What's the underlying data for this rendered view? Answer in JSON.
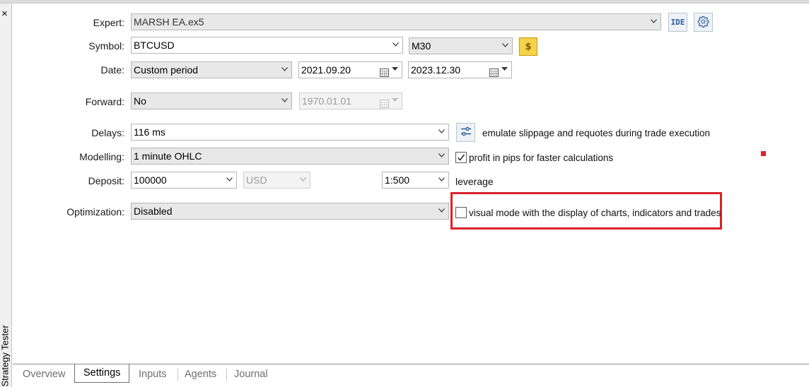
{
  "window": {
    "close_glyph": "×",
    "vertical_title": "Strategy Tester"
  },
  "expert": {
    "label": "Expert:",
    "value": "MARSH EA.ex5",
    "ide_label": "IDE",
    "settings_icon": "gear-icon"
  },
  "symbol": {
    "label": "Symbol:",
    "value": "BTCUSD",
    "timeframe": "M30",
    "symbol_icon": "dollar-icon"
  },
  "date": {
    "label": "Date:",
    "period": "Custom period",
    "from": "2021.09.20",
    "to": "2023.12.30"
  },
  "forward": {
    "label": "Forward:",
    "value": "No",
    "date": "1970.01.01"
  },
  "delays": {
    "label": "Delays:",
    "value": "116 ms",
    "option_text": "emulate slippage and requotes during trade execution",
    "option_icon": "sliders-icon"
  },
  "modelling": {
    "label": "Modelling:",
    "value": "1 minute OHLC",
    "checkbox_label": "profit in pips for faster calculations",
    "checkbox_checked": true
  },
  "deposit": {
    "label": "Deposit:",
    "value": "100000",
    "currency": "USD",
    "leverage": "1:500",
    "leverage_label": "leverage"
  },
  "optimization": {
    "label": "Optimization:",
    "value": "Disabled",
    "visual_label": "visual mode with the display of charts, indicators and trades",
    "visual_checked": false
  },
  "tabs": [
    {
      "label": "Overview",
      "active": false
    },
    {
      "label": "Settings",
      "active": true
    },
    {
      "label": "Inputs",
      "active": false
    },
    {
      "label": "Agents",
      "active": false
    },
    {
      "label": "Journal",
      "active": false
    }
  ],
  "colors": {
    "highlight": "#d9222a",
    "accent": "#2c5d9e"
  }
}
